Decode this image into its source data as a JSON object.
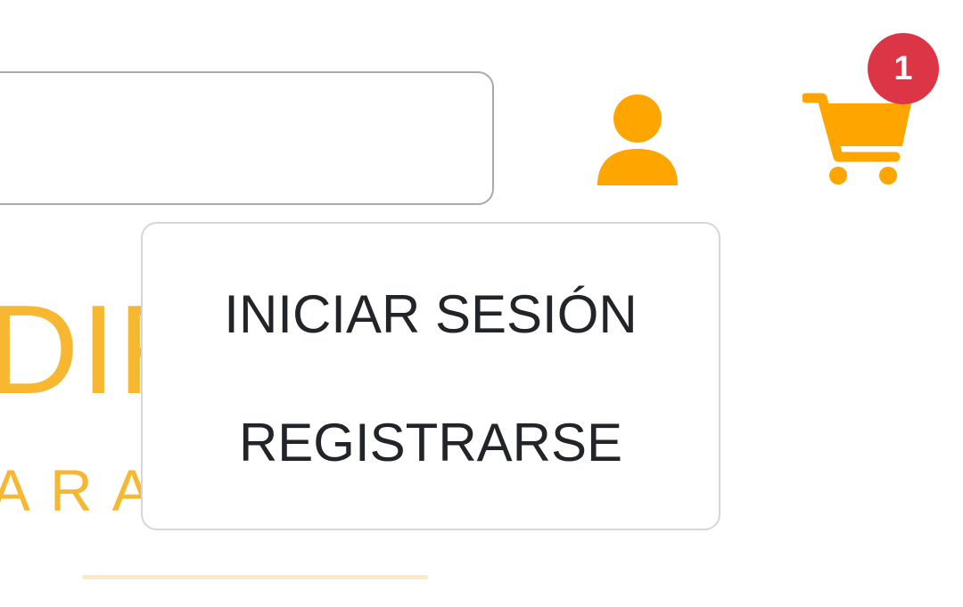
{
  "header": {
    "search": {
      "value": "",
      "placeholder": ""
    },
    "user_icon": "user-icon",
    "cart_icon": "cart-icon",
    "cart_count": "1"
  },
  "hero": {
    "title_partial": "DIR",
    "subtitle_partial": "ARA"
  },
  "account_menu": {
    "login_label": "INICIAR SESIÓN",
    "register_label": "REGISTRARSE"
  },
  "colors": {
    "accent": "#ffa500",
    "hero_text": "#f8b731",
    "badge": "#dc3545",
    "menu_text": "#212529"
  }
}
